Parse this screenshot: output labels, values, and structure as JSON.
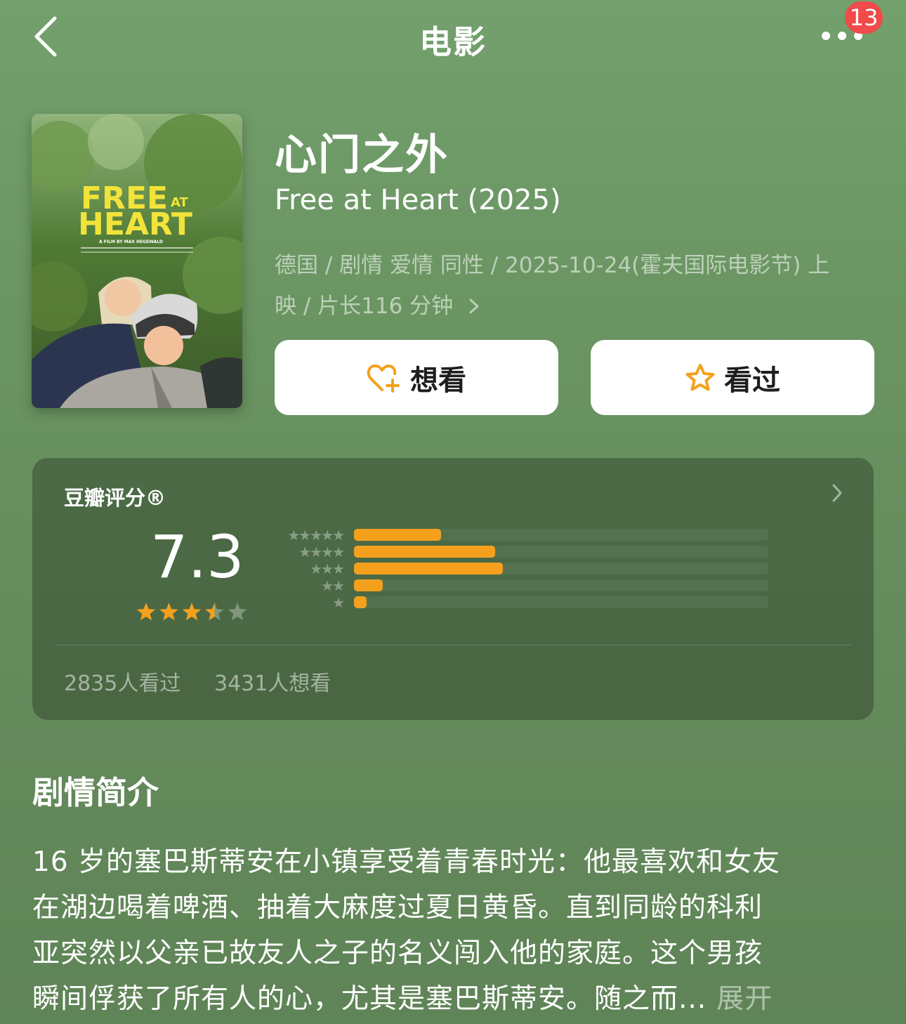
{
  "nav": {
    "title": "电影",
    "back_icon": "chevron-left-icon",
    "more_icon": "more-dots-icon",
    "badge": "13"
  },
  "movie": {
    "title_cn": "心门之外",
    "title_en": "Free at Heart (2025)",
    "meta_line1": "德国 / 剧情 爱情 同性 / 2025-10-24(霍夫国际电影节) 上",
    "meta_line2": "映 / 片长116 分钟",
    "poster": {
      "title_top": "FREE",
      "title_at": "AT",
      "title_bottom": "HEART",
      "credit": "A FILM BY MAX HEGEWALD"
    }
  },
  "actions": {
    "want_label": "想看",
    "seen_label": "看过",
    "accent": "#f5a01d"
  },
  "rating": {
    "label": "豆瓣评分®",
    "score": "7.3",
    "stars": 3.5,
    "star_rows": [
      "★★★★★",
      "★★★★",
      "★★★",
      "★★",
      "★"
    ],
    "distribution": [
      0.21,
      0.34,
      0.36,
      0.07,
      0.03
    ],
    "seen_count": "2835人看过",
    "want_count": "3431人想看"
  },
  "synopsis": {
    "heading": "剧情简介",
    "lines": [
      "16 岁的塞巴斯蒂安在小镇享受着青春时光：他最喜欢和女友",
      "在湖边喝着啤酒、抽着大麻度过夏日黄昏。直到同龄的科利",
      "亚突然以父亲已故友人之子的名义闯入他的家庭。这个男孩",
      "瞬间俘获了所有人的心，尤其是塞巴斯蒂安。随之而..."
    ],
    "expand_label": "展开"
  }
}
